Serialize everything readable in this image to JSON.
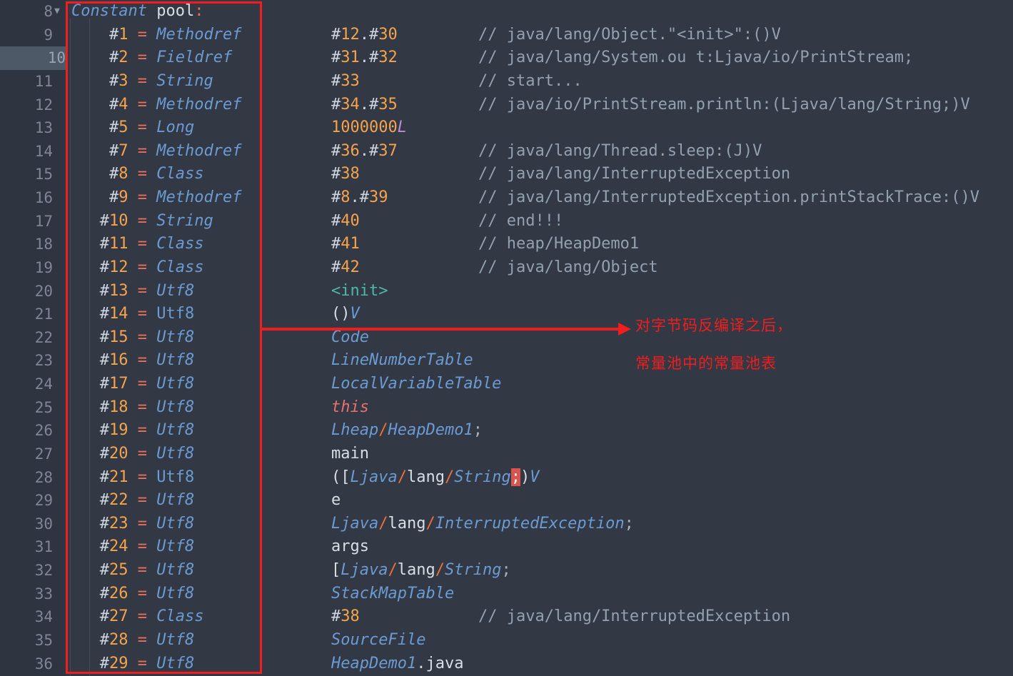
{
  "editor": {
    "background": "#323844",
    "gutter_background": "#2f3540",
    "highlighted_line": 10,
    "first_line_number": 8,
    "last_line_number": 36,
    "fold_marker": "▼",
    "fold_marker_line": 8
  },
  "line_numbers": [
    8,
    9,
    10,
    11,
    12,
    13,
    14,
    15,
    16,
    17,
    18,
    19,
    20,
    21,
    22,
    23,
    24,
    25,
    26,
    27,
    28,
    29,
    30,
    31,
    32,
    33,
    34,
    35,
    36
  ],
  "header": {
    "keyword": "Constant",
    "word": " pool",
    "colon": ":"
  },
  "constant_pool": [
    {
      "hash": "#",
      "index": "1",
      "eq": "=",
      "type": "Methodref",
      "italic": true,
      "indent": " "
    },
    {
      "hash": "#",
      "index": "2",
      "eq": "=",
      "type": "Fieldref",
      "italic": true,
      "indent": " "
    },
    {
      "hash": "#",
      "index": "3",
      "eq": "=",
      "type": "String",
      "italic": true,
      "indent": " "
    },
    {
      "hash": "#",
      "index": "4",
      "eq": "=",
      "type": "Methodref",
      "italic": true,
      "indent": " "
    },
    {
      "hash": "#",
      "index": "5",
      "eq": "=",
      "type": "Long",
      "italic": true,
      "indent": " "
    },
    {
      "hash": "#",
      "index": "7",
      "eq": "=",
      "type": "Methodref",
      "italic": true,
      "indent": " "
    },
    {
      "hash": "#",
      "index": "8",
      "eq": "=",
      "type": "Class",
      "italic": true,
      "indent": " "
    },
    {
      "hash": "#",
      "index": "9",
      "eq": "=",
      "type": "Methodref",
      "italic": true,
      "indent": " "
    },
    {
      "hash": "#",
      "index": "10",
      "eq": "=",
      "type": "String",
      "italic": true,
      "indent": ""
    },
    {
      "hash": "#",
      "index": "11",
      "eq": "=",
      "type": "Class",
      "italic": true,
      "indent": ""
    },
    {
      "hash": "#",
      "index": "12",
      "eq": "=",
      "type": "Class",
      "italic": true,
      "indent": ""
    },
    {
      "hash": "#",
      "index": "13",
      "eq": "=",
      "type": "Utf8",
      "italic": true,
      "indent": ""
    },
    {
      "hash": "#",
      "index": "14",
      "eq": "=",
      "type": "Utf8",
      "italic": false,
      "indent": ""
    },
    {
      "hash": "#",
      "index": "15",
      "eq": "=",
      "type": "Utf8",
      "italic": true,
      "indent": ""
    },
    {
      "hash": "#",
      "index": "16",
      "eq": "=",
      "type": "Utf8",
      "italic": true,
      "indent": ""
    },
    {
      "hash": "#",
      "index": "17",
      "eq": "=",
      "type": "Utf8",
      "italic": true,
      "indent": ""
    },
    {
      "hash": "#",
      "index": "18",
      "eq": "=",
      "type": "Utf8",
      "italic": true,
      "indent": ""
    },
    {
      "hash": "#",
      "index": "19",
      "eq": "=",
      "type": "Utf8",
      "italic": true,
      "indent": ""
    },
    {
      "hash": "#",
      "index": "20",
      "eq": "=",
      "type": "Utf8",
      "italic": true,
      "indent": ""
    },
    {
      "hash": "#",
      "index": "21",
      "eq": "=",
      "type": "Utf8",
      "italic": false,
      "indent": ""
    },
    {
      "hash": "#",
      "index": "22",
      "eq": "=",
      "type": "Utf8",
      "italic": true,
      "indent": ""
    },
    {
      "hash": "#",
      "index": "23",
      "eq": "=",
      "type": "Utf8",
      "italic": true,
      "indent": ""
    },
    {
      "hash": "#",
      "index": "24",
      "eq": "=",
      "type": "Utf8",
      "italic": true,
      "indent": ""
    },
    {
      "hash": "#",
      "index": "25",
      "eq": "=",
      "type": "Utf8",
      "italic": true,
      "indent": ""
    },
    {
      "hash": "#",
      "index": "26",
      "eq": "=",
      "type": "Utf8",
      "italic": true,
      "indent": ""
    },
    {
      "hash": "#",
      "index": "27",
      "eq": "=",
      "type": "Class",
      "italic": true,
      "indent": ""
    },
    {
      "hash": "#",
      "index": "28",
      "eq": "=",
      "type": "Utf8",
      "italic": true,
      "indent": ""
    },
    {
      "hash": "#",
      "index": "29",
      "eq": "=",
      "type": "Utf8",
      "italic": true,
      "indent": ""
    }
  ],
  "values": [
    {
      "kind": "ref",
      "text": "#12.#30",
      "comment": "// java/lang/Object.\"<init>\":()V"
    },
    {
      "kind": "ref",
      "text": "#31.#32",
      "comment": "// java/lang/System.ou t:Ljava/io/PrintStream;"
    },
    {
      "kind": "ref",
      "text": "#33",
      "comment": "// start..."
    },
    {
      "kind": "ref",
      "text": "#34.#35",
      "comment": "// java/io/PrintStream.println:(Ljava/lang/String;)V"
    },
    {
      "kind": "long",
      "text": "1000000L",
      "comment": ""
    },
    {
      "kind": "ref",
      "text": "#36.#37",
      "comment": "// java/lang/Thread.sleep:(J)V"
    },
    {
      "kind": "ref",
      "text": "#38",
      "comment": "// java/lang/InterruptedException"
    },
    {
      "kind": "ref",
      "text": "#8.#39",
      "comment": "// java/lang/InterruptedException.printStackTrace:()V"
    },
    {
      "kind": "ref",
      "text": "#40",
      "comment": "// end!!!"
    },
    {
      "kind": "ref",
      "text": "#41",
      "comment": "// heap/HeapDemo1"
    },
    {
      "kind": "ref",
      "text": "#42",
      "comment": "// java/lang/Object"
    },
    {
      "kind": "utf8",
      "text": "<init>",
      "comment": ""
    },
    {
      "kind": "utf8",
      "text": "()V",
      "comment": ""
    },
    {
      "kind": "utf8",
      "text": "Code",
      "comment": ""
    },
    {
      "kind": "utf8",
      "text": "LineNumberTable",
      "comment": ""
    },
    {
      "kind": "utf8",
      "text": "LocalVariableTable",
      "comment": ""
    },
    {
      "kind": "utf8",
      "text": "this",
      "comment": ""
    },
    {
      "kind": "utf8",
      "text": "Lheap/HeapDemo1;",
      "comment": ""
    },
    {
      "kind": "utf8",
      "text": "main",
      "comment": ""
    },
    {
      "kind": "utf8",
      "text": "([Ljava/lang/String;)V",
      "comment": ""
    },
    {
      "kind": "utf8",
      "text": "e",
      "comment": ""
    },
    {
      "kind": "utf8",
      "text": "Ljava/lang/InterruptedException;",
      "comment": ""
    },
    {
      "kind": "utf8",
      "text": "args",
      "comment": ""
    },
    {
      "kind": "utf8",
      "text": "[Ljava/lang/String;",
      "comment": ""
    },
    {
      "kind": "utf8",
      "text": "StackMapTable",
      "comment": ""
    },
    {
      "kind": "ref",
      "text": "#38",
      "comment": "// java/lang/InterruptedException"
    },
    {
      "kind": "utf8",
      "text": "SourceFile",
      "comment": ""
    },
    {
      "kind": "utf8",
      "text": "HeapDemo1.java",
      "comment": ""
    }
  ],
  "annotations": {
    "box_color": "#f01e1e",
    "arrow_color": "#f01e1e",
    "note_line1": "对字节码反编译之后，",
    "note_line2": "常量池中的常量池表"
  }
}
